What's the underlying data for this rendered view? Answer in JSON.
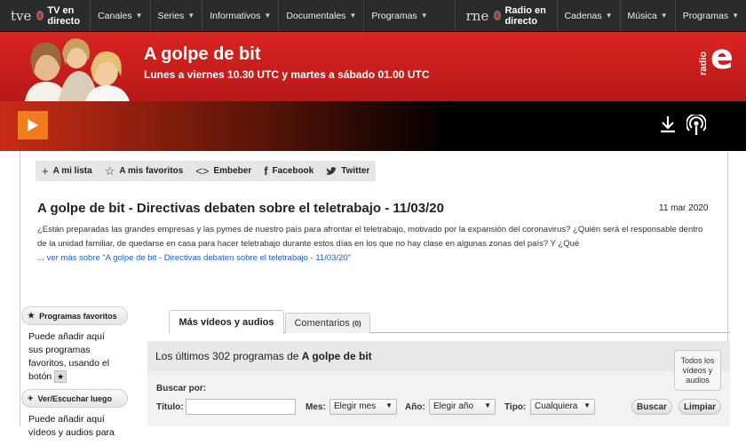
{
  "topnav": {
    "tve": {
      "logo": "tve",
      "live": "TV en directo"
    },
    "tve_menus": [
      "Canales",
      "Series",
      "Informativos",
      "Documentales",
      "Programas"
    ],
    "rne": {
      "logo": "rne",
      "live": "Radio en directo"
    },
    "rne_menus": [
      "Cadenas",
      "Música",
      "Programas"
    ],
    "caret": "▼"
  },
  "hero": {
    "title": "A golpe de bit",
    "schedule": "Lunes a viernes 10.30 UTC y martes a sábado 01.00 UTC",
    "logo_small": "radio",
    "logo_big": "e"
  },
  "player": {
    "play_icon": "play-icon",
    "download_icon": "download-icon",
    "podcast_icon": "podcast-icon"
  },
  "toolbar": {
    "mi_lista": "A mi lista",
    "favoritos": "A mis favoritos",
    "embeber": "Embeber",
    "facebook": "Facebook",
    "twitter": "Twitter"
  },
  "episode": {
    "title": "A golpe de bit - Directivas debaten sobre el teletrabajo - 11/03/20",
    "date": "11 mar 2020",
    "description": "¿Están preparadas las grandes empresas y las pymes de nuestro país para afrontar el teletrabajo, motivado por la expansión del coronavirus? ¿Quién será el responsable dentro de la unidad familiar, de quedarse en casa para hacer teletrabajo durante estos días en los que no hay clase en algunas zonas del país? Y ¿Qué",
    "ellipsis": "...",
    "more_link": "ver más sobre \"A golpe de bit - Directivas debaten sobre el teletrabajo - 11/03/20\""
  },
  "sidebar": {
    "fav_header": "Programas favoritos",
    "fav_text": "Puede añadir aquí sus programas favoritos, usando el botón",
    "later_header": "Ver/Escuchar luego",
    "later_text": "Puede añadir aquí vídeos y audios para"
  },
  "tabs": {
    "videos": "Más vídeos y audios",
    "comments": "Comentarios",
    "comments_count": "(0)"
  },
  "results": {
    "prefix": "Los últimos 302 programas de",
    "program": "A golpe de bit",
    "all_button": "Todos los vídeos y audios"
  },
  "search": {
    "label": "Buscar por:",
    "titulo_label": "Título:",
    "titulo_value": "",
    "mes_label": "Mes:",
    "mes_value": "Elegir mes",
    "ano_label": "Año:",
    "ano_value": "Elegir año",
    "tipo_label": "Tipo:",
    "tipo_value": "Cualquiera",
    "buscar": "Buscar",
    "limpiar": "Limpiar"
  },
  "colors": {
    "brand_red": "#d8251f",
    "play_orange": "#f07c1e",
    "link_blue": "#1f5fbf"
  }
}
